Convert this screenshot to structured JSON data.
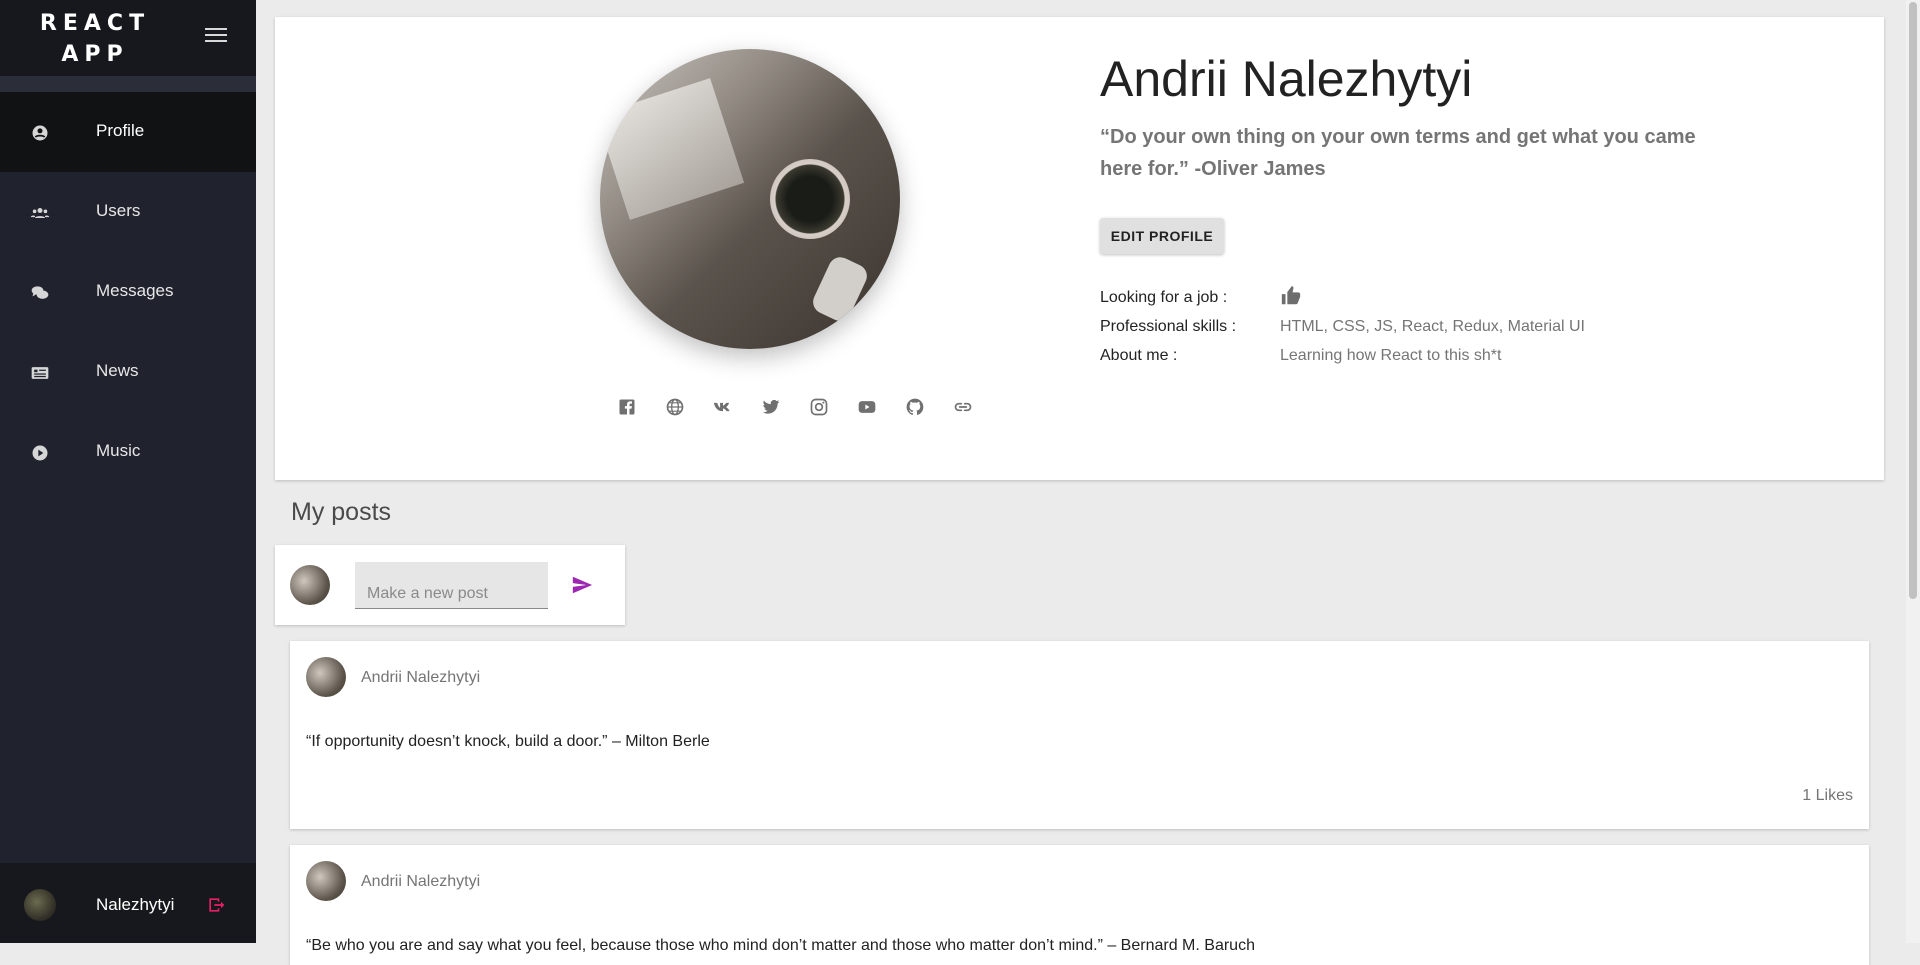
{
  "sidebar": {
    "brand": "REACT\nAPP",
    "items": [
      {
        "label": "Profile",
        "icon": "account-circle-icon"
      },
      {
        "label": "Users",
        "icon": "people-icon"
      },
      {
        "label": "Messages",
        "icon": "chat-bubbles-icon"
      },
      {
        "label": "News",
        "icon": "newspaper-icon"
      },
      {
        "label": "Music",
        "icon": "play-circle-icon"
      }
    ],
    "footer": {
      "username": "Nalezhytyi"
    }
  },
  "profile": {
    "name": "Andrii Nalezhytyi",
    "status": "“Do your own thing on your own terms and get what you came here for.” -Oliver James",
    "edit_button": "EDIT PROFILE",
    "looking_for_job_label": "Looking for a job :",
    "looking_for_job": true,
    "skills_label": "Professional skills :",
    "skills": "HTML, CSS, JS, React, Redux, Material UI",
    "about_label": "About me :",
    "about": "Learning how React to this sh*t",
    "social_icons": [
      "facebook-icon",
      "website-icon",
      "vk-icon",
      "twitter-icon",
      "instagram-icon",
      "youtube-icon",
      "github-icon",
      "link-icon"
    ]
  },
  "posts": {
    "title": "My posts",
    "new_post_placeholder": "Make a new post",
    "items": [
      {
        "author": "Andrii Nalezhytyi",
        "text": "“If opportunity doesn’t knock, build a door.” – Milton Berle",
        "likes": "1 Likes"
      },
      {
        "author": "Andrii Nalezhytyi",
        "text": "“Be who you are and say what you feel, because those who mind don’t matter and those who matter don’t mind.” – Bernard M. Baruch",
        "likes": ""
      }
    ]
  },
  "colors": {
    "sidebar_bg": "#20222e",
    "accent_send": "#9c27b0",
    "logout": "#e91e63"
  }
}
